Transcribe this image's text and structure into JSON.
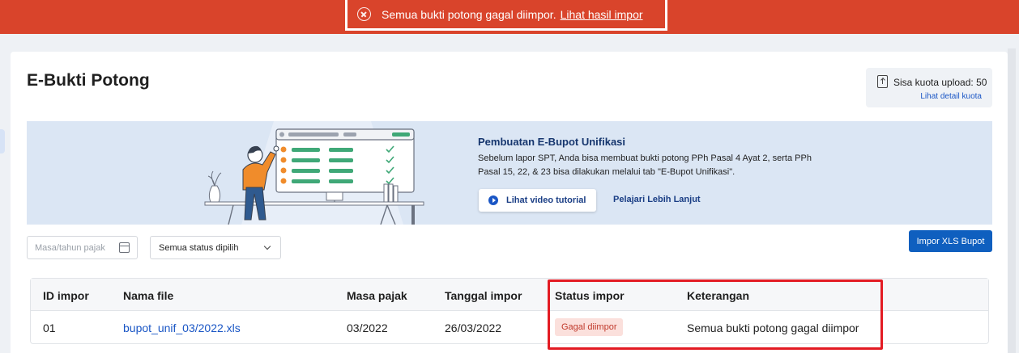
{
  "banner": {
    "message": "Semua bukti potong gagal diimpor.",
    "link": "Lihat hasil impor"
  },
  "page": {
    "title": "E-Bukti Potong"
  },
  "quota": {
    "text": "Sisa kuota upload: 50",
    "link": "Lihat detail kuota"
  },
  "promo": {
    "title": "Pembuatan E-Bupot Unifikasi",
    "description": "Sebelum lapor SPT, Anda bisa membuat bukti potong PPh Pasal 4 Ayat 2, serta PPh Pasal 15, 22, & 23 bisa dilakukan melalui tab \"E-Bupot Unifikasi\".",
    "video_button": "Lihat video tutorial",
    "learn_more": "Pelajari Lebih Lanjut"
  },
  "filters": {
    "date_placeholder": "Masa/tahun pajak",
    "status_selected": "Semua status dipilih"
  },
  "actions": {
    "import_button": "Impor XLS Bupot"
  },
  "table": {
    "headers": {
      "id": "ID impor",
      "file": "Nama file",
      "period": "Masa pajak",
      "date": "Tanggal impor",
      "status": "Status impor",
      "note": "Keterangan"
    },
    "rows": [
      {
        "id": "01",
        "file": "bupot_unif_03/2022.xls",
        "period": "03/2022",
        "date": "26/03/2022",
        "status": "Gagal diimpor",
        "note": "Semua bukti potong gagal diimpor"
      }
    ]
  },
  "colors": {
    "banner_bg": "#d9442b",
    "primary": "#0f5fbf",
    "link": "#1a56c5",
    "error_badge_bg": "#fbe0dc",
    "error_badge_text": "#c0392b",
    "highlight": "#e31b23"
  }
}
